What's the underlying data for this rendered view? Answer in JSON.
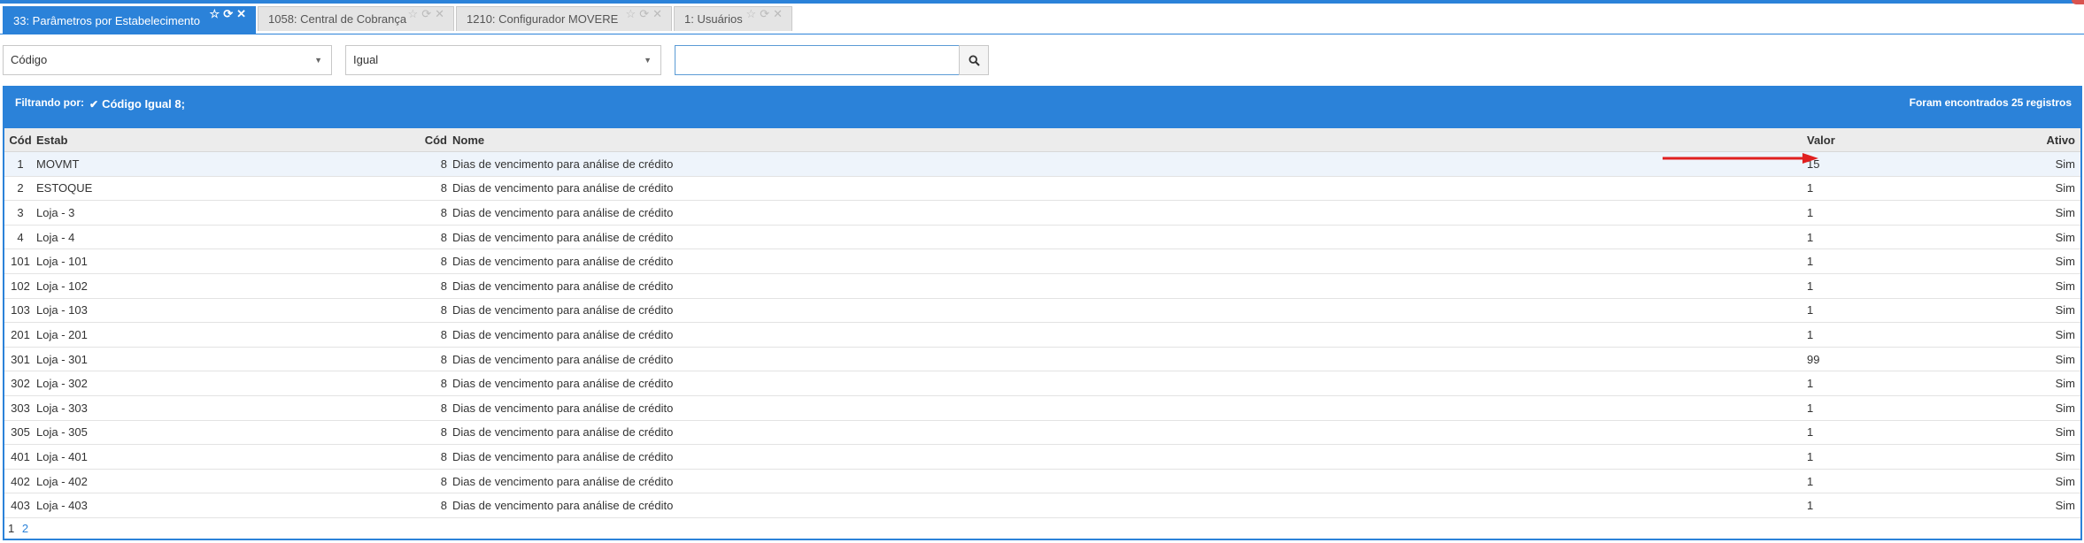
{
  "tabs": [
    {
      "label": "33: Parâmetros por Estabelecimento",
      "active": true
    },
    {
      "label": "1058: Central de Cobrança",
      "active": false
    },
    {
      "label": "1210: Configurador MOVERE",
      "active": false
    },
    {
      "label": "1: Usuários",
      "active": false
    }
  ],
  "filters": {
    "field_select": "Código",
    "operator_select": "Igual",
    "search_value": ""
  },
  "panel": {
    "filter_label": "Filtrando por:",
    "active_filter": "Código Igual 8;",
    "result_count": "Foram encontrados 25 registros"
  },
  "table": {
    "columns": [
      "Cód",
      "Estab",
      "Cód",
      "Nome",
      "Valor",
      "Ativo"
    ],
    "rows": [
      {
        "cod": "1",
        "estab": "MOVMT",
        "cod2": "8",
        "nome": "Dias de vencimento para análise de crédito",
        "valor": "15",
        "ativo": "Sim"
      },
      {
        "cod": "2",
        "estab": "ESTOQUE",
        "cod2": "8",
        "nome": "Dias de vencimento para análise de crédito",
        "valor": "1",
        "ativo": "Sim"
      },
      {
        "cod": "3",
        "estab": "Loja - 3",
        "cod2": "8",
        "nome": "Dias de vencimento para análise de crédito",
        "valor": "1",
        "ativo": "Sim"
      },
      {
        "cod": "4",
        "estab": "Loja - 4",
        "cod2": "8",
        "nome": "Dias de vencimento para análise de crédito",
        "valor": "1",
        "ativo": "Sim"
      },
      {
        "cod": "101",
        "estab": "Loja - 101",
        "cod2": "8",
        "nome": "Dias de vencimento para análise de crédito",
        "valor": "1",
        "ativo": "Sim"
      },
      {
        "cod": "102",
        "estab": "Loja - 102",
        "cod2": "8",
        "nome": "Dias de vencimento para análise de crédito",
        "valor": "1",
        "ativo": "Sim"
      },
      {
        "cod": "103",
        "estab": "Loja - 103",
        "cod2": "8",
        "nome": "Dias de vencimento para análise de crédito",
        "valor": "1",
        "ativo": "Sim"
      },
      {
        "cod": "201",
        "estab": "Loja - 201",
        "cod2": "8",
        "nome": "Dias de vencimento para análise de crédito",
        "valor": "1",
        "ativo": "Sim"
      },
      {
        "cod": "301",
        "estab": "Loja - 301",
        "cod2": "8",
        "nome": "Dias de vencimento para análise de crédito",
        "valor": "99",
        "ativo": "Sim"
      },
      {
        "cod": "302",
        "estab": "Loja - 302",
        "cod2": "8",
        "nome": "Dias de vencimento para análise de crédito",
        "valor": "1",
        "ativo": "Sim"
      },
      {
        "cod": "303",
        "estab": "Loja - 303",
        "cod2": "8",
        "nome": "Dias de vencimento para análise de crédito",
        "valor": "1",
        "ativo": "Sim"
      },
      {
        "cod": "305",
        "estab": "Loja - 305",
        "cod2": "8",
        "nome": "Dias de vencimento para análise de crédito",
        "valor": "1",
        "ativo": "Sim"
      },
      {
        "cod": "401",
        "estab": "Loja - 401",
        "cod2": "8",
        "nome": "Dias de vencimento para análise de crédito",
        "valor": "1",
        "ativo": "Sim"
      },
      {
        "cod": "402",
        "estab": "Loja - 402",
        "cod2": "8",
        "nome": "Dias de vencimento para análise de crédito",
        "valor": "1",
        "ativo": "Sim"
      },
      {
        "cod": "403",
        "estab": "Loja - 403",
        "cod2": "8",
        "nome": "Dias de vencimento para análise de crédito",
        "valor": "1",
        "ativo": "Sim"
      }
    ]
  },
  "pagination": {
    "pages": [
      "1",
      "2"
    ],
    "current": "1"
  },
  "colors": {
    "accent": "#2b82d9",
    "arrow": "#e02020",
    "row_highlight": "#eef4fb"
  },
  "icons": {
    "tab": [
      "star-icon",
      "refresh-icon",
      "close-icon"
    ],
    "search": "search-icon",
    "filter_check": "check-icon",
    "select_caret": "caret-down-icon"
  }
}
